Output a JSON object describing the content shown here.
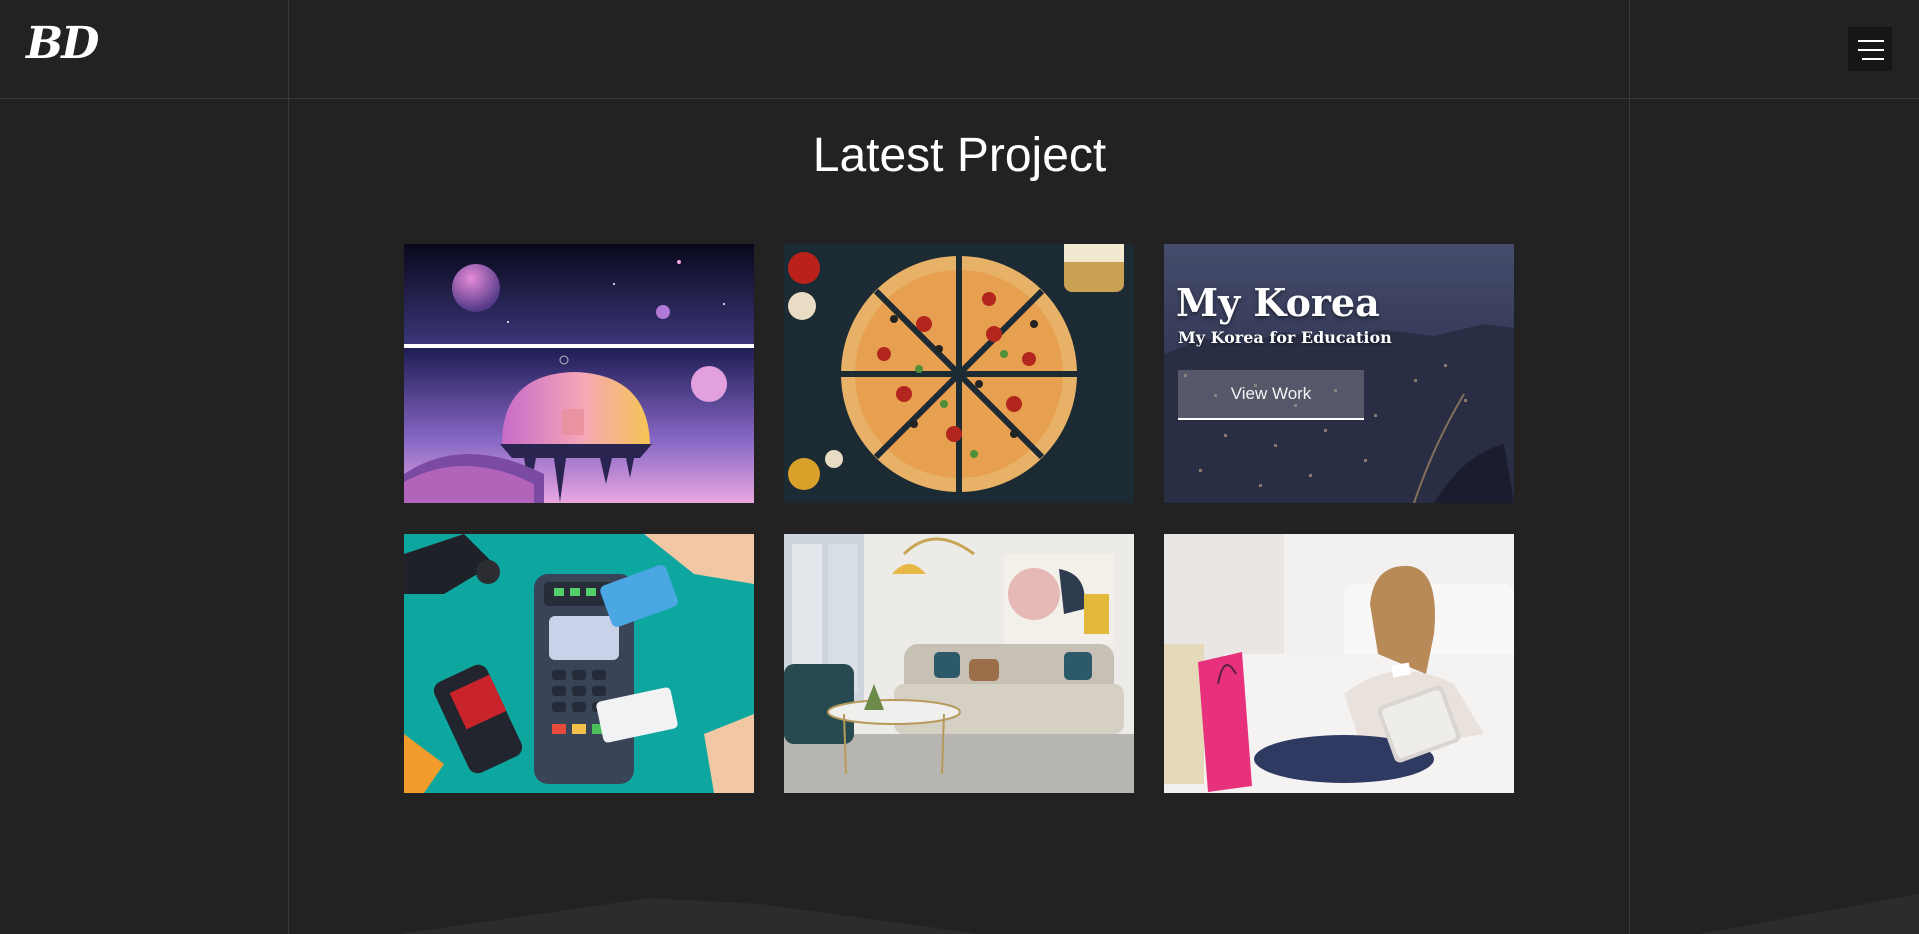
{
  "header": {
    "logo_text": "BD",
    "menu_icon": "hamburger-menu-icon"
  },
  "section": {
    "title": "Latest Project"
  },
  "projects": [
    {
      "image": "space-planet-illustration"
    },
    {
      "image": "pizza-photo"
    },
    {
      "image": "seoul-night-city-photo",
      "overlay_title": "My Korea",
      "overlay_subtitle": "My Korea for Education",
      "overlay_button": "View Work"
    },
    {
      "image": "contactless-payment-illustration"
    },
    {
      "image": "living-room-sofa-photo"
    },
    {
      "image": "woman-online-shopping-photo"
    }
  ],
  "colors": {
    "background": "#222222",
    "grid_line": "#3a3a3a",
    "text": "#ffffff"
  }
}
